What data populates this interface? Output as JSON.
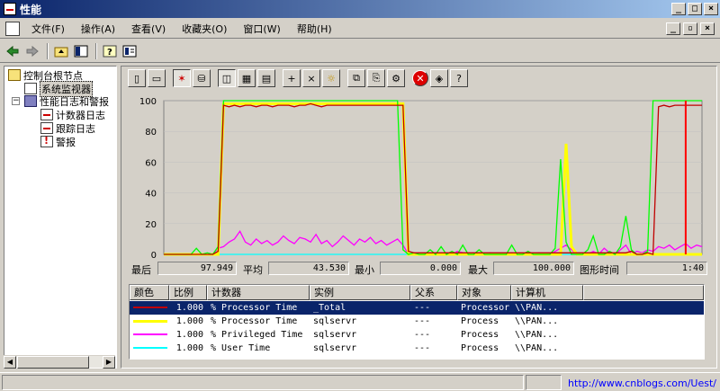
{
  "window": {
    "title": "性能",
    "controls": [
      "_",
      "□",
      "×"
    ]
  },
  "menu": {
    "items": [
      "文件(F)",
      "操作(A)",
      "查看(V)",
      "收藏夹(O)",
      "窗口(W)",
      "帮助(H)"
    ],
    "mdi_controls": [
      "_",
      "▫",
      "×"
    ]
  },
  "toolbar1": {
    "icons": [
      "back-arrow-icon",
      "forward-arrow-icon",
      "up-folder-icon",
      "show-hide-tree-icon",
      "help-icon",
      "properties-icon"
    ]
  },
  "tree": {
    "items": [
      {
        "label": "控制台根节点",
        "icon": "folder-icon"
      },
      {
        "label": "系统监视器",
        "icon": "monitor-icon"
      },
      {
        "label": "性能日志和警报",
        "icon": "book-icon"
      },
      {
        "label": "计数器日志",
        "icon": "counter-log-icon"
      },
      {
        "label": "跟踪日志",
        "icon": "trace-log-icon"
      },
      {
        "label": "警报",
        "icon": "alert-icon"
      }
    ],
    "expander": "−"
  },
  "toolbar2": {
    "buttons": [
      {
        "name": "new-counter-set-icon",
        "glyph": "▯"
      },
      {
        "name": "clear-display-icon",
        "glyph": "▭"
      },
      {
        "name": "view-current-activity-icon",
        "glyph": "✶"
      },
      {
        "name": "view-log-data-icon",
        "glyph": "⛁"
      },
      {
        "name": "view-graph-icon",
        "glyph": "◫"
      },
      {
        "name": "view-histogram-icon",
        "glyph": "▦"
      },
      {
        "name": "view-report-icon",
        "glyph": "▤"
      },
      {
        "name": "add-counter-icon",
        "glyph": "+"
      },
      {
        "name": "delete-counter-icon",
        "glyph": "×"
      },
      {
        "name": "highlight-icon",
        "glyph": "☼"
      },
      {
        "name": "copy-properties-icon",
        "glyph": "⧉"
      },
      {
        "name": "paste-counter-list-icon",
        "glyph": "⎘"
      },
      {
        "name": "properties-icon",
        "glyph": "⚙"
      },
      {
        "name": "freeze-display-icon",
        "glyph": "✕"
      },
      {
        "name": "update-data-icon",
        "glyph": "◈"
      },
      {
        "name": "help-icon",
        "glyph": "?"
      }
    ]
  },
  "chart_data": {
    "type": "line",
    "title": "",
    "xlabel": "",
    "ylabel": "",
    "ylim": [
      0,
      100
    ],
    "yticks": [
      "100",
      "80",
      "60",
      "40",
      "20",
      "0"
    ],
    "grid": true,
    "background": "#d4d0c8",
    "x": [
      0,
      1,
      2,
      3,
      4,
      5,
      6,
      7,
      8,
      9,
      10,
      11,
      12,
      13,
      14,
      15,
      16,
      17,
      18,
      19,
      20,
      21,
      22,
      23,
      24,
      25,
      26,
      27,
      28,
      29,
      30,
      31,
      32,
      33,
      34,
      35,
      36,
      37,
      38,
      39,
      40,
      41,
      42,
      43,
      44,
      45,
      46,
      47,
      48,
      49,
      50,
      51,
      52,
      53,
      54,
      55,
      56,
      57,
      58,
      59,
      60,
      61,
      62,
      63,
      64,
      65,
      66,
      67,
      68,
      69,
      70,
      71,
      72,
      73,
      74,
      75,
      76,
      77,
      78,
      79,
      80,
      81,
      82,
      83,
      84,
      85,
      86,
      87,
      88,
      89,
      90,
      91,
      92,
      93,
      94,
      95,
      96,
      97,
      98,
      99
    ],
    "series": [
      {
        "name": "% Processor Time _Total",
        "color": "#c00000",
        "values": [
          0,
          0,
          0,
          0,
          0,
          0,
          0,
          0,
          0,
          0,
          2,
          97,
          96,
          97,
          96,
          97,
          97,
          96,
          97,
          97,
          96,
          97,
          97,
          97,
          96,
          97,
          97,
          98,
          97,
          96,
          97,
          97,
          97,
          97,
          97,
          97,
          97,
          97,
          97,
          97,
          97,
          97,
          97,
          97,
          97,
          2,
          1,
          1,
          1,
          1,
          1,
          1,
          1,
          1,
          1,
          1,
          1,
          1,
          1,
          1,
          1,
          1,
          1,
          1,
          1,
          1,
          1,
          1,
          1,
          1,
          1,
          1,
          1,
          1,
          1,
          1,
          1,
          1,
          1,
          1,
          1,
          1,
          1,
          1,
          1,
          1,
          2,
          0,
          0,
          1,
          0,
          96,
          97,
          96,
          97,
          97,
          97,
          97,
          97,
          97
        ]
      },
      {
        "name": "% Processor Time sqlservr",
        "color": "#ffff00",
        "values": [
          0,
          0,
          0,
          0,
          0,
          0,
          0,
          0,
          0,
          0,
          0,
          98,
          98,
          98,
          98,
          98,
          98,
          98,
          98,
          98,
          98,
          98,
          98,
          98,
          98,
          98,
          98,
          98,
          98,
          98,
          98,
          98,
          98,
          98,
          98,
          98,
          98,
          98,
          98,
          98,
          98,
          98,
          98,
          98,
          98,
          0,
          0,
          0,
          0,
          0,
          0,
          0,
          0,
          0,
          0,
          0,
          0,
          0,
          0,
          0,
          0,
          0,
          0,
          0,
          0,
          0,
          0,
          0,
          0,
          0,
          0,
          0,
          0,
          0,
          72,
          5,
          0,
          0,
          0,
          0,
          0,
          0,
          0,
          0,
          0,
          0,
          0,
          0,
          0,
          0,
          0,
          0,
          0,
          0,
          0,
          0,
          0,
          0,
          0,
          0
        ]
      },
      {
        "name": "% Privileged Time sqlservr",
        "color": "#ff00ff",
        "values": [
          0,
          0,
          0,
          0,
          0,
          0,
          0,
          0,
          0,
          0,
          4,
          5,
          8,
          10,
          15,
          8,
          6,
          10,
          7,
          9,
          6,
          8,
          12,
          9,
          7,
          11,
          10,
          8,
          13,
          7,
          9,
          5,
          8,
          12,
          9,
          6,
          10,
          8,
          11,
          7,
          9,
          6,
          8,
          10,
          6,
          0,
          0,
          0,
          1,
          0,
          0,
          0,
          1,
          0,
          2,
          1,
          0,
          1,
          0,
          0,
          1,
          0,
          0,
          0,
          1,
          0,
          0,
          2,
          0,
          1,
          0,
          0,
          2,
          4,
          6,
          3,
          0,
          1,
          0,
          2,
          0,
          4,
          1,
          0,
          3,
          6,
          0,
          2,
          1,
          3,
          2,
          5,
          4,
          6,
          3,
          5,
          7,
          4,
          6,
          5
        ]
      },
      {
        "name": "% User Time sqlservr",
        "color": "#00ffff",
        "values": [
          0,
          0,
          0,
          0,
          0,
          0,
          0,
          0,
          0,
          0,
          0,
          0,
          0,
          0,
          0,
          0,
          0,
          0,
          0,
          0,
          0,
          0,
          0,
          0,
          0,
          0,
          0,
          0,
          0,
          0,
          0,
          0,
          0,
          0,
          0,
          0,
          0,
          0,
          0,
          0,
          0,
          0,
          0,
          0,
          0,
          0,
          0,
          0,
          0,
          0,
          0,
          0,
          0,
          0,
          0,
          0,
          0,
          0,
          0,
          0,
          0,
          0,
          0,
          0,
          0,
          0,
          0,
          0,
          0,
          0,
          0,
          0,
          0,
          0,
          0,
          0,
          0,
          0,
          0,
          0,
          0,
          0,
          0,
          0,
          0,
          0,
          0,
          0,
          0,
          0,
          0,
          0,
          0,
          0,
          0,
          0,
          0,
          0,
          0,
          0
        ]
      },
      {
        "name": "% Processor Time (green overlay)",
        "color": "#00ff00",
        "values": [
          0,
          0,
          0,
          0,
          0,
          0,
          4,
          0,
          1,
          0,
          5,
          100,
          100,
          100,
          100,
          100,
          100,
          100,
          100,
          100,
          100,
          100,
          100,
          100,
          100,
          100,
          100,
          100,
          100,
          100,
          100,
          100,
          100,
          100,
          100,
          100,
          100,
          100,
          100,
          100,
          100,
          100,
          100,
          100,
          3,
          0,
          1,
          0,
          0,
          3,
          0,
          5,
          0,
          2,
          0,
          6,
          0,
          0,
          3,
          0,
          0,
          0,
          0,
          0,
          6,
          0,
          0,
          2,
          0,
          0,
          0,
          0,
          4,
          62,
          8,
          0,
          0,
          0,
          3,
          12,
          0,
          0,
          2,
          0,
          5,
          25,
          3,
          0,
          0,
          2,
          100,
          100,
          100,
          100,
          100,
          100,
          100,
          100,
          100,
          100
        ]
      }
    ],
    "cursor_x": 96,
    "cursor_color": "#ff0000"
  },
  "stats": {
    "last_label": "最后",
    "last_value": "97.949",
    "avg_label": "平均",
    "avg_value": "43.530",
    "min_label": "最小",
    "min_value": "0.000",
    "max_label": "最大",
    "max_value": "100.000",
    "duration_label": "图形时间",
    "duration_value": "1:40"
  },
  "legend": {
    "headers": [
      "颜色",
      "比例",
      "计数器",
      "实例",
      "父系",
      "对象",
      "计算机"
    ],
    "rows": [
      {
        "color": "#c00000",
        "scale": "1.000",
        "counter": "% Processor Time",
        "instance": "_Total",
        "parent": "---",
        "object": "Processor",
        "computer": "\\\\PAN..."
      },
      {
        "color": "#ffff00",
        "scale": "1.000",
        "counter": "% Processor Time",
        "instance": "sqlservr",
        "parent": "---",
        "object": "Process",
        "computer": "\\\\PAN..."
      },
      {
        "color": "#ff00ff",
        "scale": "1.000",
        "counter": "% Privileged Time",
        "instance": "sqlservr",
        "parent": "---",
        "object": "Process",
        "computer": "\\\\PAN..."
      },
      {
        "color": "#00ffff",
        "scale": "1.000",
        "counter": "% User Time",
        "instance": "sqlservr",
        "parent": "---",
        "object": "Process",
        "computer": "\\\\PAN..."
      }
    ]
  },
  "statusbar": {
    "watermark": "http://www.cnblogs.com/Uest/"
  }
}
